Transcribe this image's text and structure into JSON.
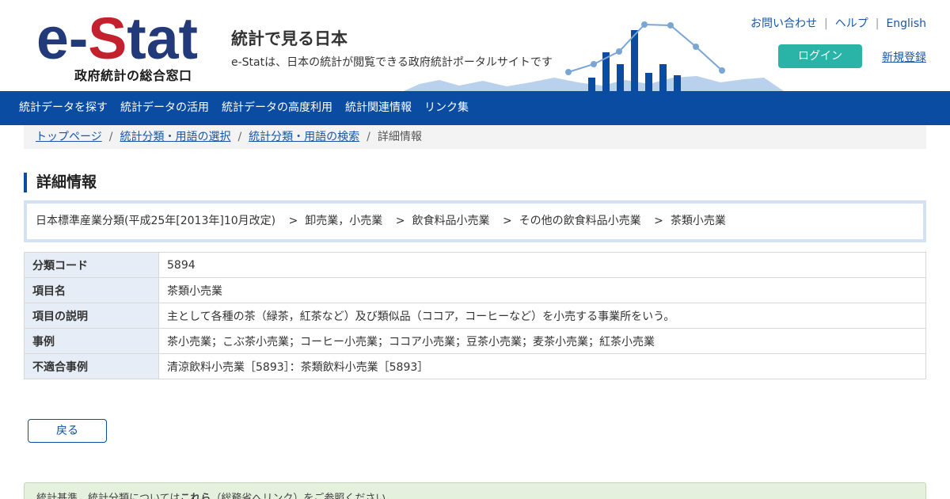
{
  "header": {
    "logo_text": "e-Stat",
    "logo_subtitle": "政府統計の総合窓口",
    "site_title": "統計で見る日本",
    "site_description": "e-Statは、日本の統計が閲覧できる政府統計ポータルサイトです",
    "util_links": [
      "お問い合わせ",
      "ヘルプ",
      "English"
    ],
    "util_separator": "|",
    "login_label": "ログイン",
    "register_label": "新規登録"
  },
  "nav": {
    "items": [
      "統計データを探す",
      "統計データの活用",
      "統計データの高度利用",
      "統計関連情報",
      "リンク集"
    ]
  },
  "breadcrumb": {
    "links": [
      "トップページ",
      "統計分類・用語の選択",
      "統計分類・用語の検索"
    ],
    "current": "詳細情報",
    "separator": "/"
  },
  "page": {
    "heading": "詳細情報",
    "classification_path": [
      "日本標準産業分類(平成25年[2013年]10月改定)",
      "卸売業，小売業",
      "飲食料品小売業",
      "その他の飲食料品小売業",
      "茶類小売業"
    ],
    "path_separator": ">",
    "table": {
      "rows": [
        {
          "label": "分類コード",
          "value": "5894"
        },
        {
          "label": "項目名",
          "value": "茶類小売業"
        },
        {
          "label": "項目の説明",
          "value": "主として各種の茶（緑茶，紅茶など）及び類似品（ココア，コーヒーなど）を小売する事業所をいう。"
        },
        {
          "label": "事例",
          "value": "茶小売業；こぶ茶小売業；コーヒー小売業；ココア小売業；豆茶小売業；麦茶小売業；紅茶小売業"
        },
        {
          "label": "不適合事例",
          "value": "清涼飲料小売業［5893］：茶類飲料小売業［5893］"
        }
      ]
    },
    "back_label": "戻る",
    "note": {
      "prefix": "統計基準，統計分類については",
      "link": "これら",
      "suffix": "（総務省へリンク）をご参照ください。"
    }
  },
  "colors": {
    "brand_blue": "#0b4ca3",
    "logo_red": "#c4212f",
    "logo_navy": "#233a7a",
    "login_teal": "#2ab4a7",
    "link_blue": "#1856a8",
    "note_green": "#e3f1dd"
  }
}
